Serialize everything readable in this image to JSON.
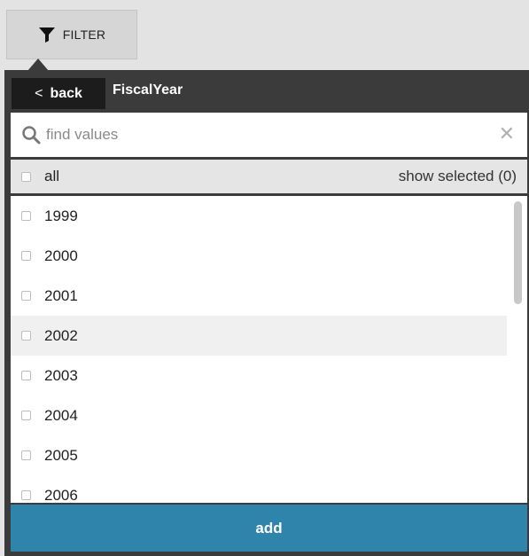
{
  "filter_button": {
    "label": "FILTER",
    "icon": "funnel-icon"
  },
  "header": {
    "back_label": "back",
    "title": "FiscalYear"
  },
  "search": {
    "placeholder": "find values",
    "value": ""
  },
  "all_row": {
    "label": "all",
    "show_selected": "show selected (0)"
  },
  "items": [
    {
      "label": "1999",
      "checked": false
    },
    {
      "label": "2000",
      "checked": false
    },
    {
      "label": "2001",
      "checked": false
    },
    {
      "label": "2002",
      "checked": false
    },
    {
      "label": "2003",
      "checked": false
    },
    {
      "label": "2004",
      "checked": false
    },
    {
      "label": "2005",
      "checked": false
    },
    {
      "label": "2006",
      "checked": false
    }
  ],
  "add_button": {
    "label": "add"
  },
  "colors": {
    "panel": "#3b3b3b",
    "back_button": "#1c1c1c",
    "add_button": "#2f84ab",
    "hover_row": "#f0f0f0"
  }
}
